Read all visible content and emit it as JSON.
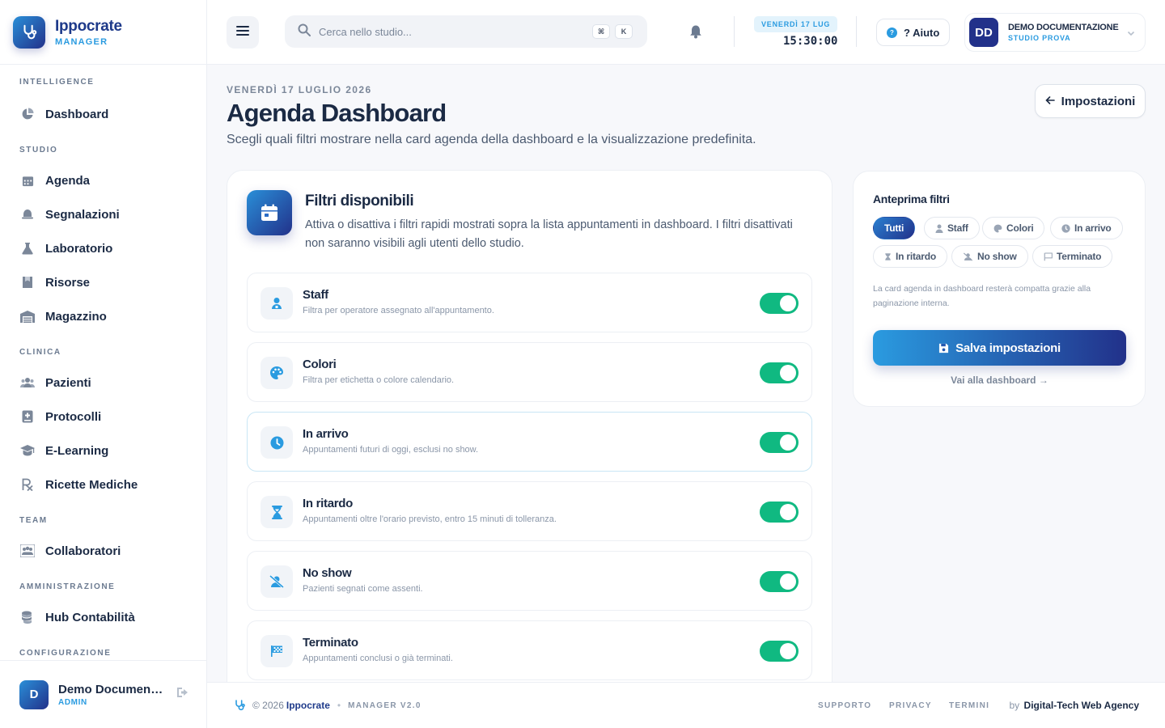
{
  "brand": {
    "name": "Ippocrate",
    "sub": "MANAGER"
  },
  "sidebar": {
    "sections": [
      {
        "label": "INTELLIGENCE",
        "items": [
          {
            "label": "Dashboard",
            "icon": "pie-chart-icon"
          }
        ]
      },
      {
        "label": "STUDIO",
        "items": [
          {
            "label": "Agenda",
            "icon": "calendar-icon"
          },
          {
            "label": "Segnalazioni",
            "icon": "bell-icon"
          },
          {
            "label": "Laboratorio",
            "icon": "flask-icon"
          },
          {
            "label": "Risorse",
            "icon": "bookmark-icon"
          },
          {
            "label": "Magazzino",
            "icon": "warehouse-icon"
          }
        ]
      },
      {
        "label": "CLINICA",
        "items": [
          {
            "label": "Pazienti",
            "icon": "users-icon"
          },
          {
            "label": "Protocolli",
            "icon": "medical-file-icon"
          },
          {
            "label": "E-Learning",
            "icon": "graduation-cap-icon"
          },
          {
            "label": "Ricette Mediche",
            "icon": "prescription-icon"
          }
        ]
      },
      {
        "label": "TEAM",
        "items": [
          {
            "label": "Collaboratori",
            "icon": "team-icon"
          }
        ]
      },
      {
        "label": "AMMINISTRAZIONE",
        "items": [
          {
            "label": "Hub Contabilità",
            "icon": "coins-icon"
          }
        ]
      },
      {
        "label": "CONFIGURAZIONE",
        "items": []
      }
    ],
    "footer": {
      "avatar": "D",
      "name": "Demo Documentazione",
      "role": "ADMIN"
    }
  },
  "topbar": {
    "search_placeholder": "Cerca nello studio...",
    "kbd1": "⌘",
    "kbd2": "K",
    "date_badge": "VENERDÌ 17 LUG",
    "clock": "15:30:00",
    "help_label": "? Aiuto",
    "user": {
      "initials": "DD",
      "name": "DEMO DOCUMENTAZIONE",
      "studio": "STUDIO PROVA"
    }
  },
  "page": {
    "date": "VENERDÌ 17 LUGLIO 2026",
    "title": "Agenda Dashboard",
    "description": "Scegli quali filtri mostrare nella card agenda della dashboard e la visualizzazione predefinita.",
    "back_label": "Impostazioni"
  },
  "filters_card": {
    "title": "Filtri disponibili",
    "description": "Attiva o disattiva i filtri rapidi mostrati sopra la lista appuntamenti in dashboard. I filtri disattivati non saranno visibili agli utenti dello studio.",
    "filters": [
      {
        "name": "Staff",
        "desc": "Filtra per operatore assegnato all'appuntamento.",
        "enabled": true,
        "icon": "staff-icon"
      },
      {
        "name": "Colori",
        "desc": "Filtra per etichetta o colore calendario.",
        "enabled": true,
        "icon": "palette-icon"
      },
      {
        "name": "In arrivo",
        "desc": "Appuntamenti futuri di oggi, esclusi no show.",
        "enabled": true,
        "icon": "clock-icon"
      },
      {
        "name": "In ritardo",
        "desc": "Appuntamenti oltre l'orario previsto, entro 15 minuti di tolleranza.",
        "enabled": true,
        "icon": "hourglass-icon"
      },
      {
        "name": "No show",
        "desc": "Pazienti segnati come assenti.",
        "enabled": true,
        "icon": "user-slash-icon"
      },
      {
        "name": "Terminato",
        "desc": "Appuntamenti conclusi o già terminati.",
        "enabled": true,
        "icon": "checkered-flag-icon"
      }
    ]
  },
  "preview": {
    "title": "Anteprima filtri",
    "chips": [
      "Tutti",
      "Staff",
      "Colori",
      "In arrivo",
      "In ritardo",
      "No show",
      "Terminato"
    ],
    "active_chip": "Tutti",
    "note": "La card agenda in dashboard resterà compatta grazie alla paginazione interna.",
    "save_label": "Salva impostazioni",
    "link_label": "Vai alla dashboard →"
  },
  "footer": {
    "copyright": "© 2026",
    "brand": "Ippocrate",
    "version": "MANAGER V2.0",
    "links": [
      "SUPPORTO",
      "PRIVACY",
      "TERMINI"
    ],
    "by_prefix": "by",
    "agency": "Digital-Tech Web Agency"
  },
  "colors": {
    "accent": "#2a9be0",
    "brand_dark": "#22318a",
    "toggle_on": "#10b981"
  }
}
